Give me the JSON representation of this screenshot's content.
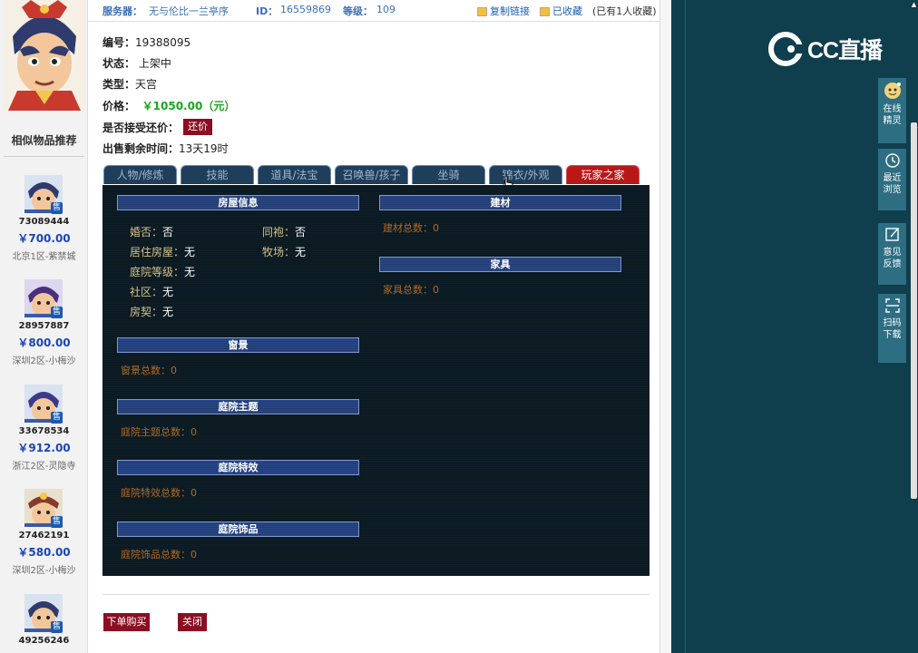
{
  "header": {
    "server_label": "服务器：",
    "server_value": "无与伦比一兰亭序",
    "id_label": "ID：",
    "id_value": "16559869",
    "level_label": "等级：",
    "level_value": "109",
    "copy_link": "复制链接",
    "favorited": "已收藏",
    "fav_count": "(已有1人收藏)"
  },
  "info": {
    "serial_label": "编号：",
    "serial_value": "19388095",
    "status_label": "状态：",
    "status_value": "上架中",
    "type_label": "类型：",
    "type_value": "天宫",
    "price_label": "价格：",
    "price_value": "￥1050.00（元）",
    "bargain_label": "是否接受还价：",
    "bargain_button": "还价",
    "time_label": "出售剩余时间：",
    "time_value": "13天19时"
  },
  "tabs": [
    {
      "label": "人物/修炼"
    },
    {
      "label": "技能"
    },
    {
      "label": "道具/法宝"
    },
    {
      "label": "召唤兽/孩子"
    },
    {
      "label": "坐骑"
    },
    {
      "label": "锦衣/外观"
    },
    {
      "label": "玩家之家"
    }
  ],
  "house": {
    "title": "房屋信息",
    "married_label": "婚否：",
    "married_value": "否",
    "robe_label": "同袍：",
    "robe_value": "否",
    "residence_label": "居住房屋：",
    "residence_value": "无",
    "ranch_label": "牧场：",
    "ranch_value": "无",
    "yard_label": "庭院等级：",
    "yard_value": "无",
    "community_label": "社区：",
    "community_value": "无",
    "deed_label": "房契：",
    "deed_value": "无"
  },
  "sections": {
    "window_title": "窗景",
    "window_count": "窗景总数：0",
    "theme_title": "庭院主题",
    "theme_count": "庭院主题总数：0",
    "effect_title": "庭院特效",
    "effect_count": "庭院特效总数：0",
    "decor_title": "庭院饰品",
    "decor_count": "庭院饰品总数：0",
    "material_title": "建材",
    "material_count": "建材总数：0",
    "furniture_title": "家具",
    "furniture_count": "家具总数：0"
  },
  "actions": {
    "order_button": "下单购买",
    "close_button": "关闭"
  },
  "sidebar": {
    "title": "相似物品推荐",
    "sell_badge": "售",
    "items": [
      {
        "id": "73089444",
        "price": "￥700.00",
        "server": "北京1区-紫禁城"
      },
      {
        "id": "28957887",
        "price": "￥800.00",
        "server": "深圳2区-小梅沙"
      },
      {
        "id": "33678534",
        "price": "￥912.00",
        "server": "浙江2区-灵隐寺"
      },
      {
        "id": "27462191",
        "price": "￥580.00",
        "server": "深圳2区-小梅沙"
      },
      {
        "id": "49256246",
        "price": "",
        "server": ""
      }
    ]
  },
  "cc": {
    "logo_text": "CC直播",
    "side": [
      {
        "label_1": "在线",
        "label_2": "精灵"
      },
      {
        "label_1": "最近",
        "label_2": "浏览"
      },
      {
        "label_1": "意见",
        "label_2": "反馈"
      },
      {
        "label_1": "扫码",
        "label_2": "下载"
      }
    ]
  },
  "colors": {
    "price_green": "#19a81e",
    "accent_red": "#8b0e22",
    "active_tab": "#b81818",
    "cc_bg": "#0f3e4d"
  }
}
